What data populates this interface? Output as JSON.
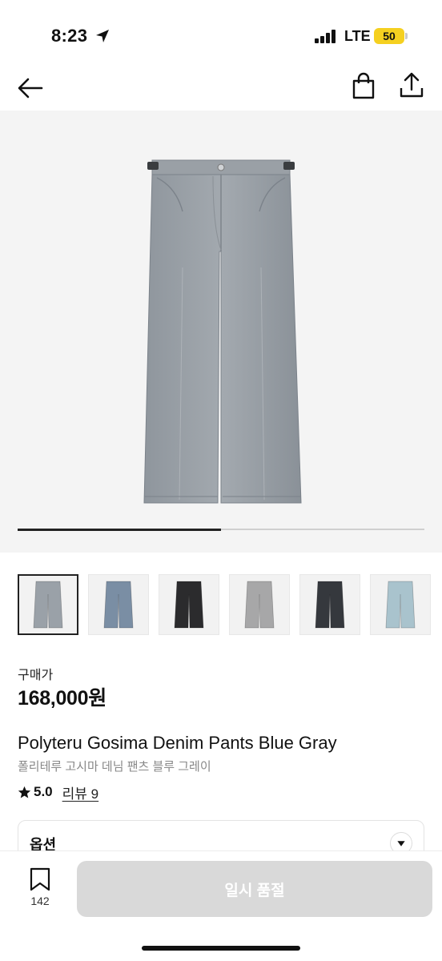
{
  "status_bar": {
    "time": "8:23",
    "network": "LTE",
    "battery": "50",
    "battery_color": "#f5d020"
  },
  "nav": {
    "back_icon": "arrow-left-icon",
    "bag_icon": "shopping-bag-icon",
    "share_icon": "share-icon"
  },
  "gallery": {
    "image_subject": "gray wide-leg denim pants",
    "progress_fraction": 0.5,
    "thumbnails": [
      {
        "color": "#9aa1a8",
        "active": true
      },
      {
        "color": "#7a8ea4",
        "active": false
      },
      {
        "color": "#2b2b2d",
        "active": false
      },
      {
        "color": "#a7a7a8",
        "active": false
      },
      {
        "color": "#35383d",
        "active": false
      },
      {
        "color": "#a9c3cd",
        "active": false
      }
    ]
  },
  "product": {
    "price_label": "구매가",
    "price": "168,000원",
    "title_en": "Polyteru Gosima Denim Pants Blue Gray",
    "title_ko": "폴리테루 고시마 데님 팬츠 블루 그레이",
    "rating": "5.0",
    "review_link": "리뷰 9"
  },
  "options": {
    "title": "옵션"
  },
  "bottom_bar": {
    "bookmark_count": "142",
    "cta_label": "일시 품절",
    "cta_color": "#d9d9d9"
  }
}
